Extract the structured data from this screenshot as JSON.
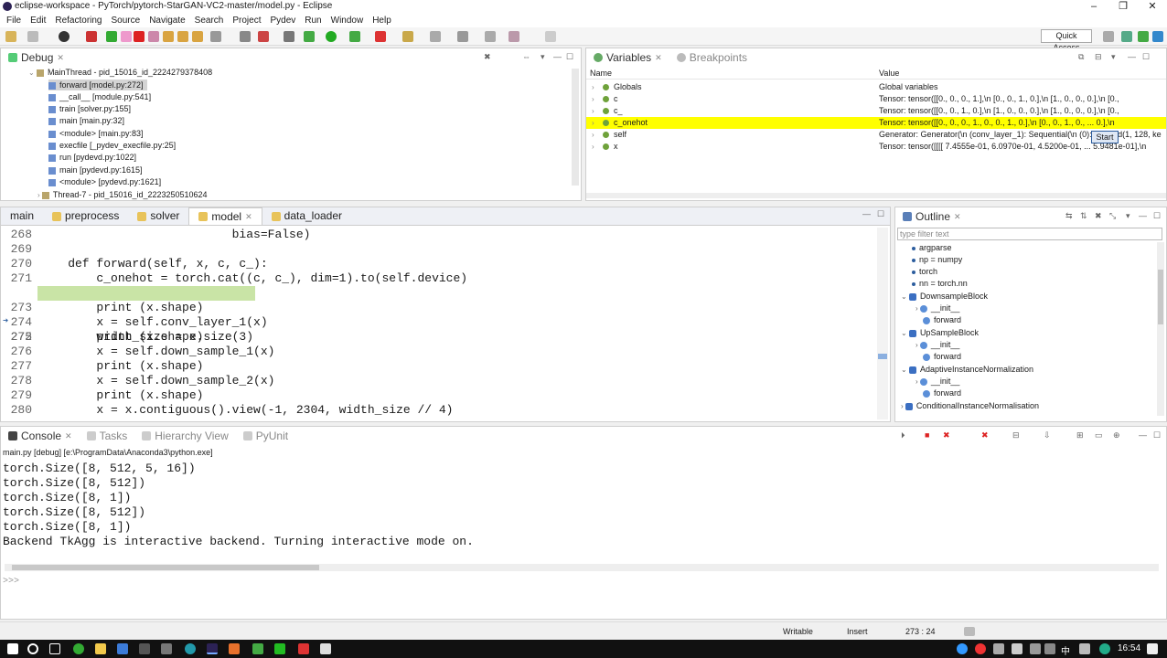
{
  "window": {
    "title": "eclipse-workspace - PyTorch/pytorch-StarGAN-VC2-master/model.py - Eclipse",
    "min": "–",
    "max": "❐",
    "close": "✕"
  },
  "menu": [
    "File",
    "Edit",
    "Refactoring",
    "Source",
    "Navigate",
    "Search",
    "Project",
    "Pydev",
    "Run",
    "Window",
    "Help"
  ],
  "toolbar": {
    "quick_access": "Quick Access"
  },
  "debug": {
    "tab": "Debug",
    "rows": [
      {
        "label": "MainThread - pid_15016_id_2224279378408",
        "depth": 1
      },
      {
        "label": "forward [model.py:272]",
        "depth": 2
      },
      {
        "label": "__call__ [module.py:541]",
        "depth": 2
      },
      {
        "label": "train [solver.py:155]",
        "depth": 2
      },
      {
        "label": "main [main.py:32]",
        "depth": 2
      },
      {
        "label": "<module> [main.py:83]",
        "depth": 2
      },
      {
        "label": "execfile [_pydev_execfile.py:25]",
        "depth": 2
      },
      {
        "label": "run [pydevd.py:1022]",
        "depth": 2
      },
      {
        "label": "main [pydevd.py:1615]",
        "depth": 2
      },
      {
        "label": "<module> [pydevd.py:1621]",
        "depth": 2
      },
      {
        "label": "Thread-7 - pid_15016_id_2223250510624",
        "depth": 1
      }
    ]
  },
  "variables": {
    "tab": "Variables",
    "tab2": "Breakpoints",
    "col_name": "Name",
    "col_value": "Value",
    "rows": [
      {
        "name": "Globals",
        "value": "Global variables"
      },
      {
        "name": "c",
        "value": "Tensor: tensor([[0., 0., 0., 1.],\\n        [0., 0., 1., 0.],\\n        [1., 0., 0., 0.],\\n        [0.,"
      },
      {
        "name": "c_",
        "value": "Tensor: tensor([[0., 0., 1., 0.],\\n        [1., 0., 0., 0.],\\n        [1., 0., 0., 0.],\\n        [0.,"
      },
      {
        "name": "c_onehot",
        "value": "Tensor: tensor([[0., 0., 0., 1., 0., 0., 1., 0.],\\n      [0., 0., 1., 0., ...  0.],\\n"
      },
      {
        "name": "self",
        "value": "Generator: Generator(\\n  (conv_layer_1): Sequential(\\n    (0): Conv2d(1, 128, ke"
      },
      {
        "name": "x",
        "value": "Tensor: tensor([[[[ 7.4555e-01,  6.0970e-01,  4.5200e-01, ...  5.9481e-01],\\n"
      }
    ],
    "tooltip": "Start"
  },
  "editor": {
    "tabs": [
      "main",
      "preprocess",
      "solver",
      "model",
      "data_loader"
    ],
    "active_tab": "model",
    "lines": [
      {
        "n": "268",
        "code": "                           bias=False)"
      },
      {
        "n": "269",
        "code": ""
      },
      {
        "n": "270",
        "code": "    def forward(self, x, c, c_):"
      },
      {
        "n": "271",
        "code": "        c_onehot = torch.cat((c, c_), dim=1).to(self.device)"
      },
      {
        "n": "272",
        "code": "        width_size = x.size(3)"
      },
      {
        "n": "273",
        "code": "        print (x.shape)"
      },
      {
        "n": "274",
        "code": "        x = self.conv_layer_1(x)"
      },
      {
        "n": "275",
        "code": "        print (x.shape)"
      },
      {
        "n": "276",
        "code": "        x = self.down_sample_1(x)"
      },
      {
        "n": "277",
        "code": "        print (x.shape)"
      },
      {
        "n": "278",
        "code": "        x = self.down_sample_2(x)"
      },
      {
        "n": "279",
        "code": "        print (x.shape)"
      },
      {
        "n": "280",
        "code": "        x = x.contiguous().view(-1, 2304, width_size // 4)"
      }
    ]
  },
  "outline": {
    "tab": "Outline",
    "filter_placeholder": "type filter text",
    "rows": [
      {
        "label": "argparse",
        "depth": 1,
        "kind": "import"
      },
      {
        "label": "np = numpy",
        "depth": 1,
        "kind": "import"
      },
      {
        "label": "torch",
        "depth": 1,
        "kind": "import"
      },
      {
        "label": "nn = torch.nn",
        "depth": 1,
        "kind": "import"
      },
      {
        "label": "DownsampleBlock",
        "depth": 1,
        "kind": "class"
      },
      {
        "label": "__init__",
        "depth": 2,
        "kind": "method"
      },
      {
        "label": "forward",
        "depth": 2,
        "kind": "method"
      },
      {
        "label": "UpSampleBlock",
        "depth": 1,
        "kind": "class"
      },
      {
        "label": "__init__",
        "depth": 2,
        "kind": "method"
      },
      {
        "label": "forward",
        "depth": 2,
        "kind": "method"
      },
      {
        "label": "AdaptiveInstanceNormalization",
        "depth": 1,
        "kind": "class"
      },
      {
        "label": "__init__",
        "depth": 2,
        "kind": "method"
      },
      {
        "label": "forward",
        "depth": 2,
        "kind": "method"
      },
      {
        "label": "ConditionalInstanceNormalisation",
        "depth": 1,
        "kind": "class"
      }
    ]
  },
  "console": {
    "tabs": [
      "Console",
      "Tasks",
      "Hierarchy View",
      "PyUnit"
    ],
    "process": "main.py [debug] [e:\\ProgramData\\Anaconda3\\python.exe]",
    "lines": [
      "torch.Size([8, 512, 5, 16])",
      "torch.Size([8, 512])",
      "torch.Size([8, 1])",
      "torch.Size([8, 512])",
      "torch.Size([8, 1])",
      "Backend TkAgg is interactive backend. Turning interactive mode on."
    ],
    "prompt": ">>>"
  },
  "status": {
    "writable": "Writable",
    "insert": "Insert",
    "position": "273 : 24"
  },
  "taskbar": {
    "time": "16:54",
    "lang": "中"
  },
  "colors": {
    "highlight_var": "#ffff00",
    "current_line": "#c9e4a6",
    "accent": "#2c5d9e"
  }
}
